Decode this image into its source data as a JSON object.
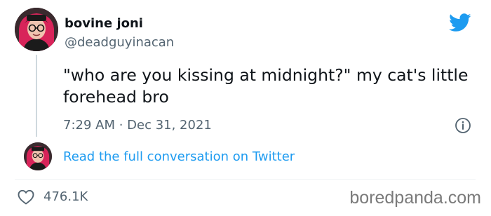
{
  "author": {
    "display_name": "bovine joni",
    "handle": "@deadguyinacan"
  },
  "tweet": {
    "text": "\"who are you kissing at midnight?\" my cat's little forehead bro",
    "timestamp": "7:29 AM · Dec 31, 2021"
  },
  "thread": {
    "read_more_label": "Read the full conversation on Twitter"
  },
  "engagement": {
    "likes": "476.1K"
  },
  "icons": {
    "brand": "twitter-bird-icon",
    "info": "info-icon",
    "like": "heart-icon"
  },
  "watermark": "boredpanda.com",
  "colors": {
    "accent": "#1d9bf0",
    "text": "#0f1419",
    "muted": "#536471",
    "avatar_hair": "#d8245a"
  }
}
